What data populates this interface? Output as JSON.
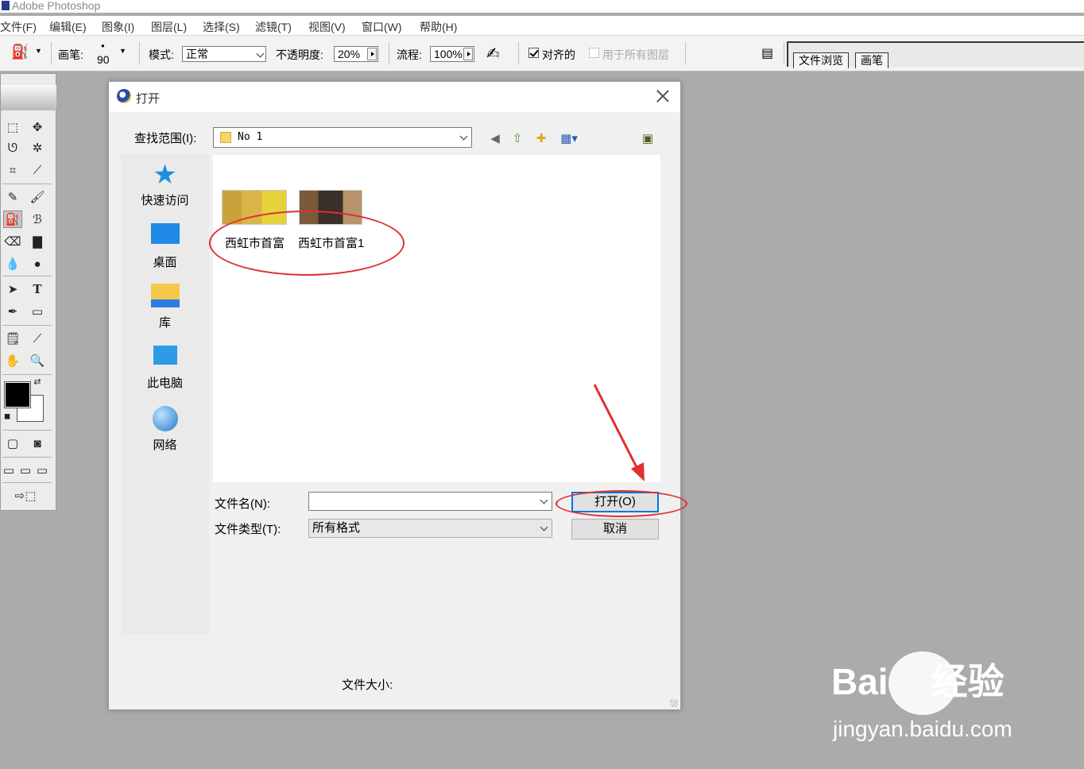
{
  "app": {
    "title": "Adobe Photoshop"
  },
  "menu": [
    "文件(F)",
    "编辑(E)",
    "图象(I)",
    "图层(L)",
    "选择(S)",
    "滤镜(T)",
    "视图(V)",
    "窗口(W)",
    "帮助(H)"
  ],
  "options": {
    "brush_label": "画笔:",
    "brush_size": "90",
    "mode_label": "模式:",
    "mode_value": "正常",
    "opacity_label": "不透明度:",
    "opacity_value": "20%",
    "flow_label": "流程:",
    "flow_value": "100%",
    "aligned_label": "对齐的",
    "aligned_checked": true,
    "all_layers_label": "用于所有图层",
    "all_layers_checked": false
  },
  "palette_tabs": [
    "文件浏览",
    "画笔"
  ],
  "dialog": {
    "title": "打开",
    "look_in_label": "查找范围(I):",
    "look_in_value": "No 1",
    "places": [
      "快速访问",
      "桌面",
      "库",
      "此电脑",
      "网络"
    ],
    "files": [
      {
        "name": "西虹市首富"
      },
      {
        "name": "西虹市首富1"
      }
    ],
    "filename_label": "文件名(N):",
    "filename_value": "",
    "filetype_label": "文件类型(T):",
    "filetype_value": "所有格式",
    "open_button": "打开(O)",
    "cancel_button": "取消",
    "file_size_label": "文件大小:"
  },
  "colors": {
    "background": "#ababab",
    "highlight_red": "#e03030",
    "accent_blue": "#0078d7",
    "foreground_color": "#000000",
    "background_color": "#ffffff"
  },
  "watermark": {
    "logo": "Bai du 经验",
    "url": "jingyan.baidu.com"
  }
}
